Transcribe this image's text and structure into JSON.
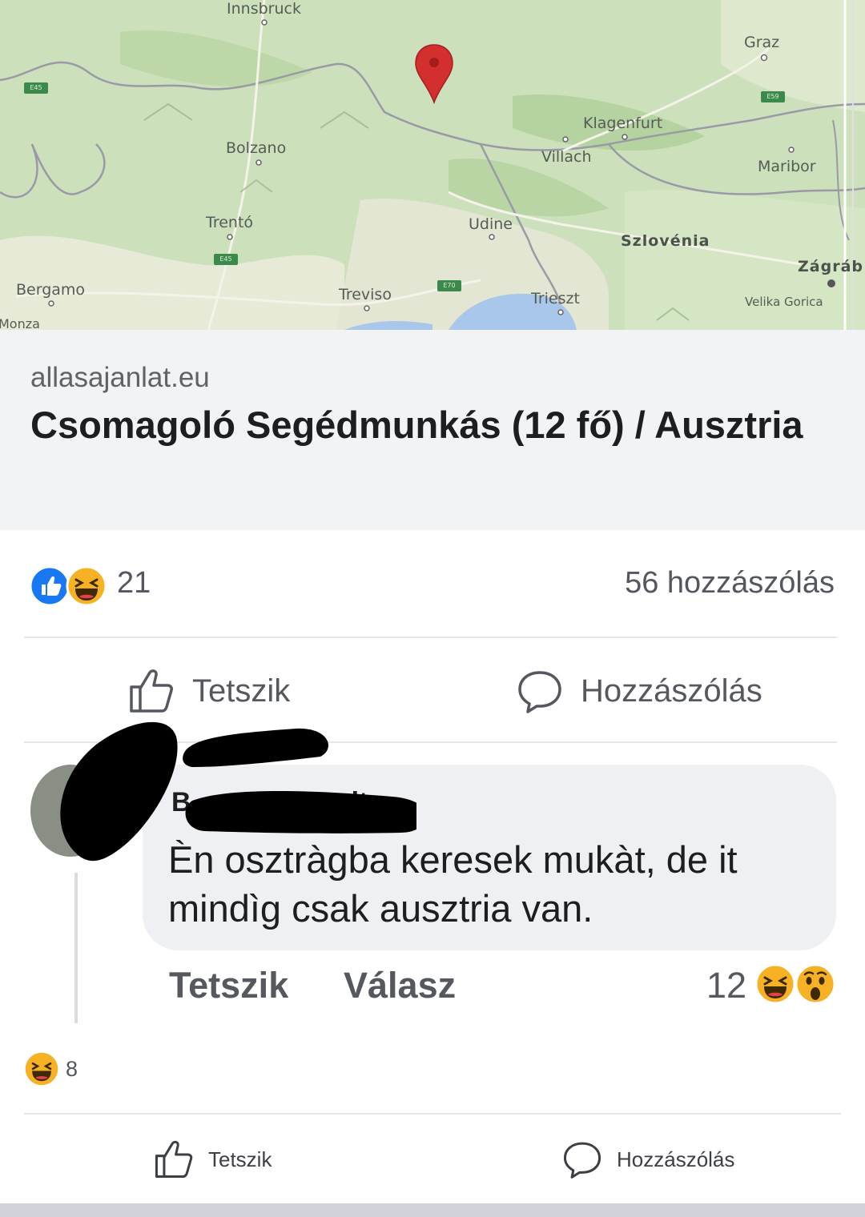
{
  "map": {
    "cities": {
      "innsbruck": "Innsbruck",
      "graz": "Graz",
      "bolzano": "Bolzano",
      "klagenfurt": "Klagenfurt",
      "villach": "Villach",
      "maribor": "Maribor",
      "trento": "Trentó",
      "udine": "Udine",
      "szlovenia": "Szlovénia",
      "zagrab": "Zágráb",
      "bergamo": "Bergamo",
      "treviso": "Treviso",
      "trieszt": "Trieszt",
      "velika_gorica": "Velika Gorica",
      "monza": "Monza"
    },
    "pin_color": "#d32f2f",
    "marker_icon": "map-pin-icon"
  },
  "link_preview": {
    "domain": "allasajanlat.eu",
    "title": "Csomagoló Segédmunkás (12 fő) / Ausztria"
  },
  "post": {
    "reaction_icons": [
      "like-icon",
      "haha-icon"
    ],
    "reaction_count": "21",
    "comment_count": "56 hozzászólás",
    "actions": {
      "like": "Tetszik",
      "comment": "Hozzászólás"
    }
  },
  "comment": {
    "author_visible_start": "B",
    "author_visible_end": "lt",
    "text": "Èn osztràgba keresek mukàt, de it mindìg csak ausztria van.",
    "actions": {
      "like": "Tetszik",
      "reply": "Válasz"
    },
    "reaction_count": "12",
    "reaction_icons": [
      "haha-icon",
      "wow-icon"
    ]
  },
  "footer": {
    "reaction_icon": "haha-icon",
    "reaction_count": "8",
    "actions": {
      "like": "Tetszik",
      "comment": "Hozzászólás"
    }
  },
  "colors": {
    "like_blue": "#1877f2",
    "reaction_yellow": "#f7b125",
    "text_secondary": "#55585e"
  }
}
